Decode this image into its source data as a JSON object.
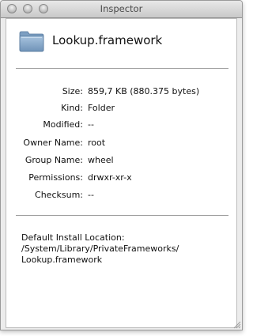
{
  "window": {
    "title": "Inspector"
  },
  "file": {
    "name": "Lookup.framework",
    "icon": "folder-icon"
  },
  "info": [
    {
      "label": "Size:",
      "value": "859,7 KB (880.375 bytes)"
    },
    {
      "label": "Kind:",
      "value": "Folder"
    },
    {
      "label": "Modified:",
      "value": "--"
    },
    {
      "label": "Owner Name:",
      "value": "root"
    },
    {
      "label": "Group Name:",
      "value": "wheel"
    },
    {
      "label": "Permissions:",
      "value": "drwxr-xr-x"
    },
    {
      "label": "Checksum:",
      "value": "--"
    }
  ],
  "install": {
    "line1": "Default Install Location:",
    "line2": "/System/Library/PrivateFrameworks/",
    "line3": "Lookup.framework"
  }
}
